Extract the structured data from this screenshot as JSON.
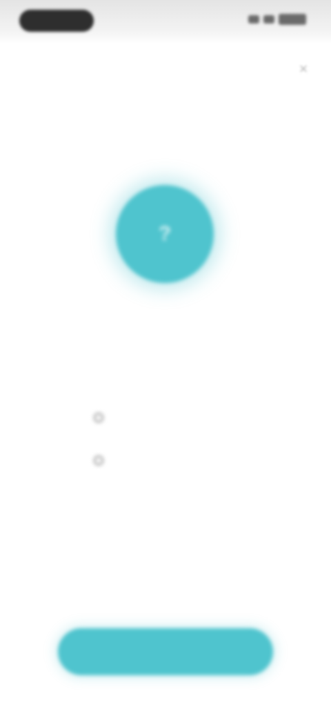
{
  "status_bar": {
    "time": "",
    "icons": [
      "signal-icon",
      "wifi-icon",
      "battery-icon"
    ]
  },
  "header": {
    "close_icon": "close-icon",
    "close_glyph": "×"
  },
  "hero": {
    "icon": "check-icon",
    "glyph": "?",
    "color": "#4fc4ce"
  },
  "content": {
    "title": "",
    "subtitle": "",
    "options": [
      {
        "label": "",
        "icon": "radio-icon"
      },
      {
        "label": "",
        "icon": "radio-icon"
      }
    ]
  },
  "footer": {
    "note": "",
    "button_label": "",
    "accent": "#4fc4ce"
  }
}
